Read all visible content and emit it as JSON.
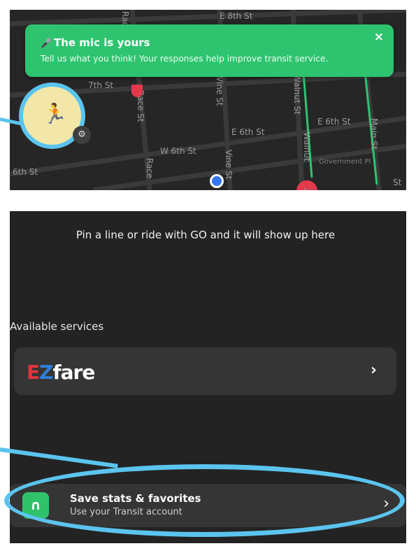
{
  "map": {
    "streets": {
      "e8th": "E 8th St",
      "w7th": "7th St",
      "race_upper": "Race St",
      "race_mid": "Race St",
      "race_lower": "Race",
      "vine_upper": "Vine St",
      "vine_lower": "Vine St",
      "e6th_left": "E 6th St",
      "w6th": "W 6th St",
      "sixth_left": "6th St",
      "e6th_right": "E 6th St",
      "walnut_upper": "Walnut St",
      "walnut_lower": "Walnut",
      "main": "Main St",
      "gov": "Government Pl",
      "st_bottom_right": "St"
    }
  },
  "toast": {
    "title": "The mic is yours",
    "message": "Tell us what you think! Your responses help improve transit service.",
    "close": "×"
  },
  "panel": {
    "empty_message": "Pin a line or ride with GO and it will show up here",
    "services_label": "Available services",
    "service_logo": {
      "e": "E",
      "z": "Z",
      "fare": "fare"
    },
    "service_chevron": "›",
    "account_icon": "∩",
    "account_title": "Save stats & favorites",
    "account_subtitle": "Use your Transit account",
    "account_chevron": "›"
  },
  "colors": {
    "toast": "#2ec46f",
    "highlight": "#5bc4ee",
    "panel": "#232323",
    "card": "#353535",
    "accent_green": "#30c26b"
  }
}
